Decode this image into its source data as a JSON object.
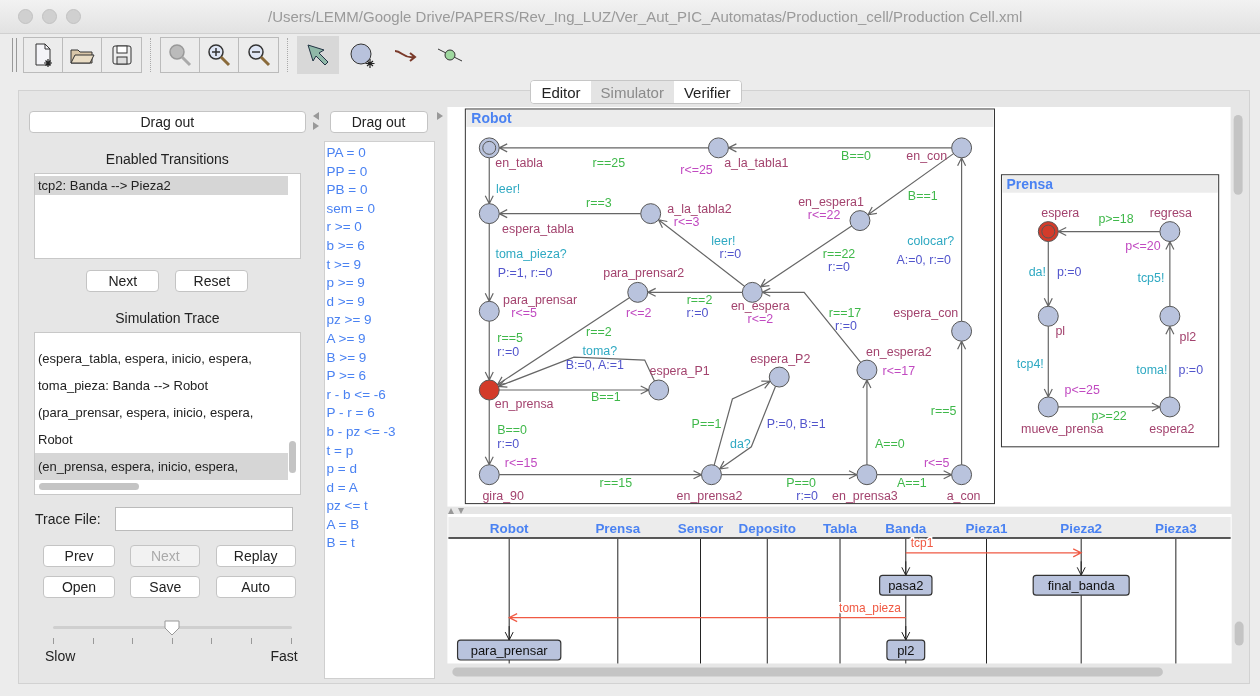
{
  "window": {
    "title": "/Users/LEMM/Google Drive/PAPERS/Rev_Ing_LUZ/Ver_Aut_PIC_Automatas/Production_cell/Production Cell.xml"
  },
  "file_buttons": [
    {
      "kind": "new"
    },
    {
      "kind": "open"
    },
    {
      "kind": "save"
    }
  ],
  "zoom_buttons": [
    {
      "kind": "fit"
    },
    {
      "kind": "in"
    },
    {
      "kind": "out"
    }
  ],
  "tools": [
    {
      "kind": "select",
      "selected": true
    },
    {
      "kind": "location",
      "selected": false
    },
    {
      "kind": "edge",
      "selected": false
    },
    {
      "kind": "nail",
      "selected": false
    }
  ],
  "tabs": [
    {
      "label": "Editor",
      "selected": false
    },
    {
      "label": "Simulator",
      "selected": true
    },
    {
      "label": "Verifier",
      "selected": false
    }
  ],
  "left": {
    "drag_out": "Drag out",
    "enabled_transitions": {
      "title": "Enabled Transitions",
      "items": [
        {
          "label": "tcp2: Banda --> Pieza2",
          "selected": true
        }
      ]
    },
    "transition_buttons": [
      "Next",
      "Reset"
    ],
    "trace": {
      "title": "Simulation Trace",
      "items": [
        {
          "label": "(espera_tabla, espera, inicio, espera,",
          "selected": false
        },
        {
          "label": "toma_pieza: Banda --> Robot",
          "selected": false
        },
        {
          "label": "(para_prensar, espera, inicio, espera,",
          "selected": false
        },
        {
          "label": "Robot",
          "selected": false
        },
        {
          "label": "(en_prensa, espera, inicio, espera,",
          "selected": true
        }
      ]
    },
    "trace_file": {
      "label": "Trace File:"
    },
    "trace_buttons": [
      {
        "label": "Prev",
        "disabled": false
      },
      {
        "label": "Next",
        "disabled": true
      },
      {
        "label": "Replay",
        "disabled": false
      },
      {
        "label": "Open",
        "disabled": false
      },
      {
        "label": "Save",
        "disabled": false
      },
      {
        "label": "Auto",
        "disabled": false
      }
    ],
    "speed": {
      "level": 0.5,
      "min_label": "Slow",
      "max_label": "Fast"
    }
  },
  "variables": {
    "drag_out": "Drag out",
    "items": [
      "PA = 0",
      "PP = 0",
      "PB = 0",
      "sem = 0",
      "r >= 0",
      "b >= 6",
      "t >= 9",
      "p >= 9",
      "d >= 9",
      "pz >= 9",
      "A >= 9",
      "B >= 9",
      "P >= 6",
      "r - b <= -6",
      "P - r = 6",
      "b - pz <= -3",
      "t = p",
      "p = d",
      "d = A",
      "pz <= t",
      "A = B",
      "B = t"
    ]
  },
  "processes": [
    {
      "title": "Robot",
      "locations": [
        {
          "name": "en_tabla",
          "initial": true,
          "current": false
        },
        {
          "name": "a_la_tabla1",
          "invariant": "r<=25",
          "initial": false,
          "current": false
        },
        {
          "name": "en_con",
          "initial": false,
          "current": false
        },
        {
          "name": "espera_tabla",
          "initial": false,
          "current": false
        },
        {
          "name": "a_la_tabla2",
          "invariant": "r<=3",
          "initial": false,
          "current": false
        },
        {
          "name": "en_espera1",
          "invariant": "r<=22",
          "initial": false,
          "current": false
        },
        {
          "name": "para_prensar",
          "invariant": "r<=5",
          "initial": false,
          "current": false
        },
        {
          "name": "para_prensar2",
          "invariant": "r<=2",
          "initial": false,
          "current": false
        },
        {
          "name": "en_espera",
          "invariant": "r<=2",
          "initial": false,
          "current": false
        },
        {
          "name": "espera_con",
          "initial": false,
          "current": false
        },
        {
          "name": "en_prensa",
          "initial": false,
          "current": true
        },
        {
          "name": "espera_P1",
          "initial": false,
          "current": false
        },
        {
          "name": "espera_P2",
          "initial": false,
          "current": false
        },
        {
          "name": "en_espera2",
          "invariant": "r<=17",
          "initial": false,
          "current": false
        },
        {
          "name": "gira_90",
          "invariant": "r<=15",
          "initial": false,
          "current": false
        },
        {
          "name": "en_prensa2",
          "initial": false,
          "current": false
        },
        {
          "name": "en_prensa3",
          "initial": false,
          "current": false
        },
        {
          "name": "a_con",
          "invariant": "r<=5",
          "initial": false,
          "current": false
        }
      ],
      "edges": [
        {
          "guard": "r==25"
        },
        {
          "guard": "B==0"
        },
        {
          "sync": "leer!"
        },
        {
          "guard": "r==3"
        },
        {
          "guard": "B==1"
        },
        {
          "sync": "leer!",
          "update": "r:=0"
        },
        {
          "guard": "r==22",
          "update": "r:=0"
        },
        {
          "sync": "colocar?",
          "update": "A:=0, r:=0"
        },
        {
          "sync": "toma_pieza?",
          "update": "P:=1, r:=0"
        },
        {
          "guard": "r==2",
          "update": "r:=0"
        },
        {
          "guard": "r==17",
          "update": "r:=0"
        },
        {
          "guard": "r==5",
          "update": "r:=0"
        },
        {
          "guard": "r==2"
        },
        {
          "sync": "toma?",
          "update": "B:=0, A:=1"
        },
        {
          "guard": "B==1"
        },
        {
          "guard": "B==0",
          "update": "r:=0"
        },
        {
          "guard": "r==15"
        },
        {
          "guard": "P==1"
        },
        {
          "sync": "da?",
          "update": "P:=0, B:=1"
        },
        {
          "guard": "P==0",
          "update": "r:=0"
        },
        {
          "guard": "A==0"
        },
        {
          "guard": "A==1"
        },
        {
          "guard": "r==5"
        }
      ]
    },
    {
      "title": "Prensa",
      "locations": [
        {
          "name": "espera",
          "initial": true,
          "current": true
        },
        {
          "name": "regresa",
          "invariant": "p<=20",
          "initial": false,
          "current": false
        },
        {
          "name": "pl",
          "initial": false,
          "current": false
        },
        {
          "name": "pl2",
          "initial": false,
          "current": false
        },
        {
          "name": "mueve_prensa",
          "invariant": "p<=25",
          "initial": false,
          "current": false
        },
        {
          "name": "espera2",
          "initial": false,
          "current": false
        }
      ],
      "edges": [
        {
          "guard": "p>=18"
        },
        {
          "sync": "da!",
          "update": "p:=0"
        },
        {
          "sync": "tcp4!"
        },
        {
          "guard": "p>=22"
        },
        {
          "sync": "toma!",
          "update": "p:=0"
        },
        {
          "sync": "tcp5!"
        }
      ]
    }
  ],
  "msc": {
    "processes": [
      "Robot",
      "Prensa",
      "Sensor",
      "Deposito",
      "Tabla",
      "Banda",
      "Pieza1",
      "Pieza2",
      "Pieza3"
    ],
    "rows": [
      {
        "kind": "message",
        "label": "tcp1"
      },
      {
        "kind": "states",
        "states": [
          "pasa2",
          "final_banda"
        ]
      },
      {
        "kind": "message",
        "label": "toma_pieza"
      },
      {
        "kind": "states",
        "states": [
          "para_prensar",
          "pl2"
        ]
      }
    ]
  }
}
